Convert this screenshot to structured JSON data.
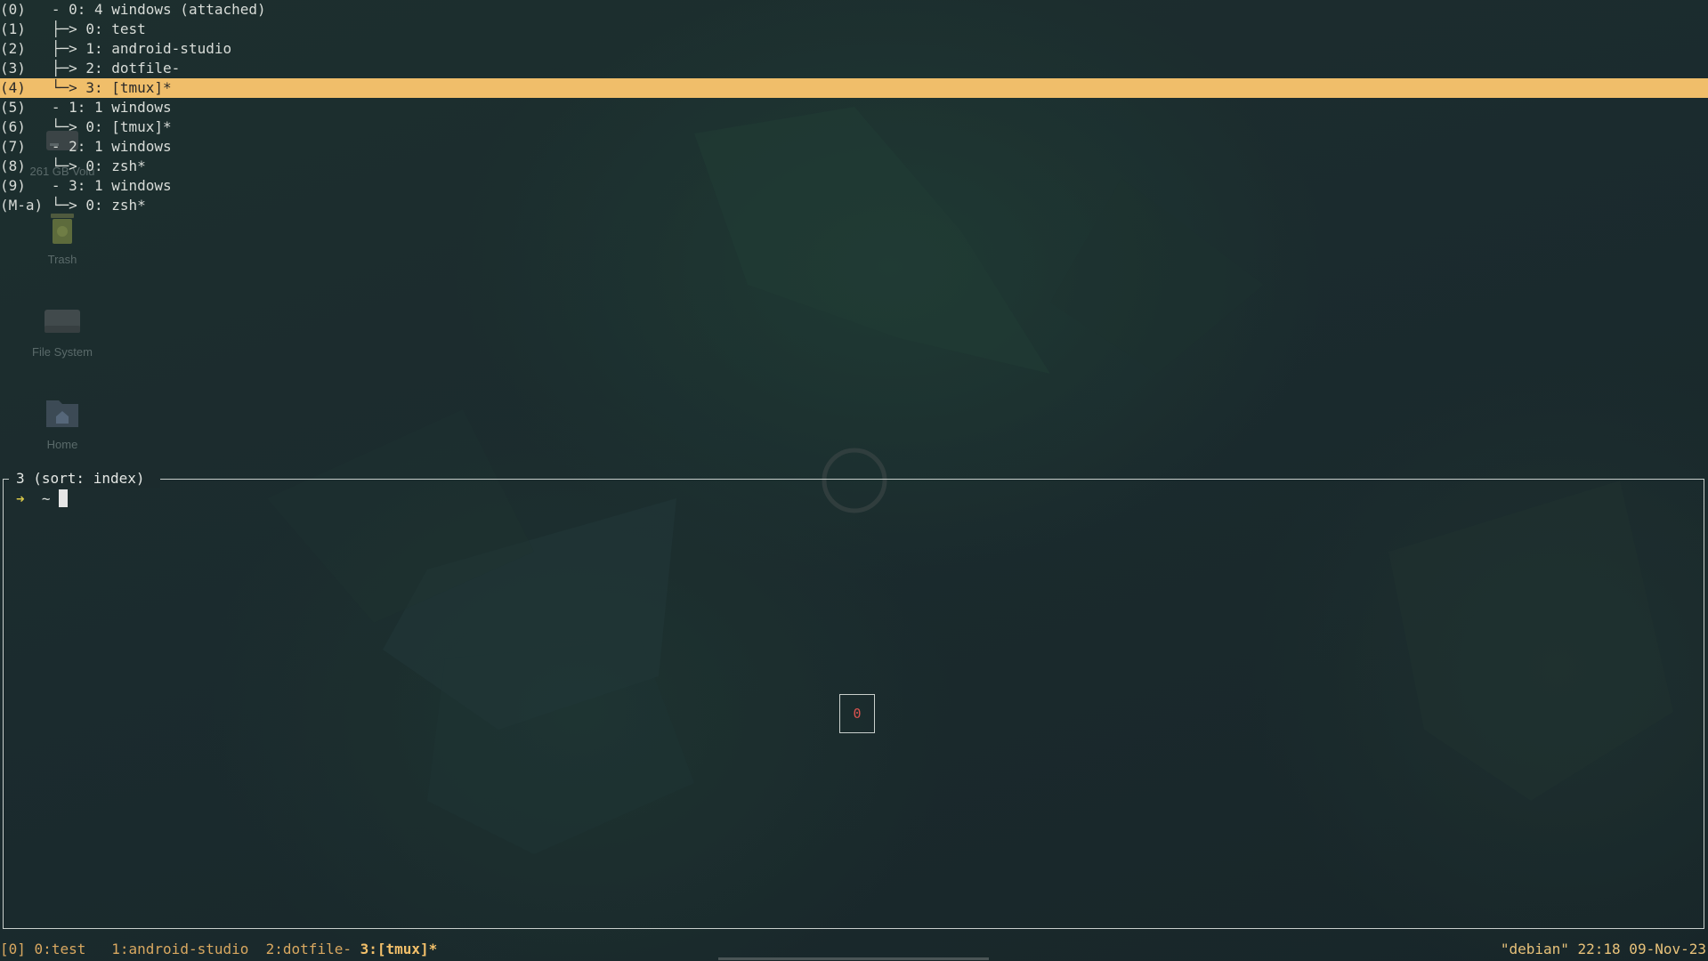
{
  "desktop": {
    "icons": [
      {
        "label": "261 GB Volu",
        "icon": "drive-icon"
      },
      {
        "label": "Trash",
        "icon": "trash-icon"
      },
      {
        "label": "File System",
        "icon": "harddisk-icon"
      },
      {
        "label": "Home",
        "icon": "home-folder-icon"
      }
    ]
  },
  "tree": {
    "rows": [
      {
        "key": "(0)",
        "text": "  - 0: 4 windows (attached)"
      },
      {
        "key": "(1)",
        "text": "  ├─> 0: test"
      },
      {
        "key": "(2)",
        "text": "  ├─> 1: android-studio"
      },
      {
        "key": "(3)",
        "text": "  ├─> 2: dotfile-"
      },
      {
        "key": "(4)",
        "text": "  └─> 3: [tmux]*"
      },
      {
        "key": "(5)",
        "text": "  - 1: 1 windows"
      },
      {
        "key": "(6)",
        "text": "  └─> 0: [tmux]*"
      },
      {
        "key": "(7)",
        "text": "  - 2: 1 windows"
      },
      {
        "key": "(8)",
        "text": "  └─> 0: zsh*"
      },
      {
        "key": "(9)",
        "text": "  - 3: 1 windows"
      },
      {
        "key": "(M-a)",
        "text": "└─> 0: zsh*"
      }
    ],
    "selected_index": 4
  },
  "preview": {
    "title": "3 (sort: index)",
    "prompt_arrow": "➜",
    "prompt_dir": "~"
  },
  "indicator": {
    "value": "0"
  },
  "statusbar": {
    "session": "[0]",
    "windows": [
      {
        "label": "0:test",
        "active": false
      },
      {
        "label": "1:android-studio",
        "active": false
      },
      {
        "label": "2:dotfile-",
        "active": false
      },
      {
        "label": "3:[tmux]*",
        "active": true
      }
    ],
    "right": "\"debian\" 22:18 09-Nov-23"
  },
  "colors": {
    "selection": "#f0be6a",
    "status_accent": "#f3c06a",
    "prompt_arrow": "#d8c84a",
    "indicator_text": "#d9534f"
  }
}
